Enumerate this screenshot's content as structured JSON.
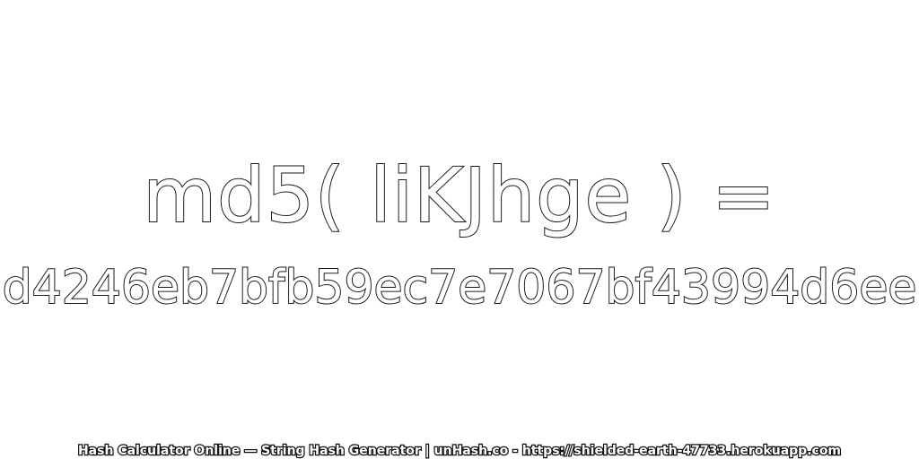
{
  "expression": "md5( liKJhge ) =",
  "hash": "d4246eb7bfb59ec7e7067bf43994d6ee",
  "footer": "Hash Calculator Online — String Hash Generator | unHash.co - https://shielded-earth-47733.herokuapp.com",
  "colors": {
    "background": "#ffffff",
    "text_fill": "#ffffff",
    "text_outline": "#1a1a1a"
  }
}
